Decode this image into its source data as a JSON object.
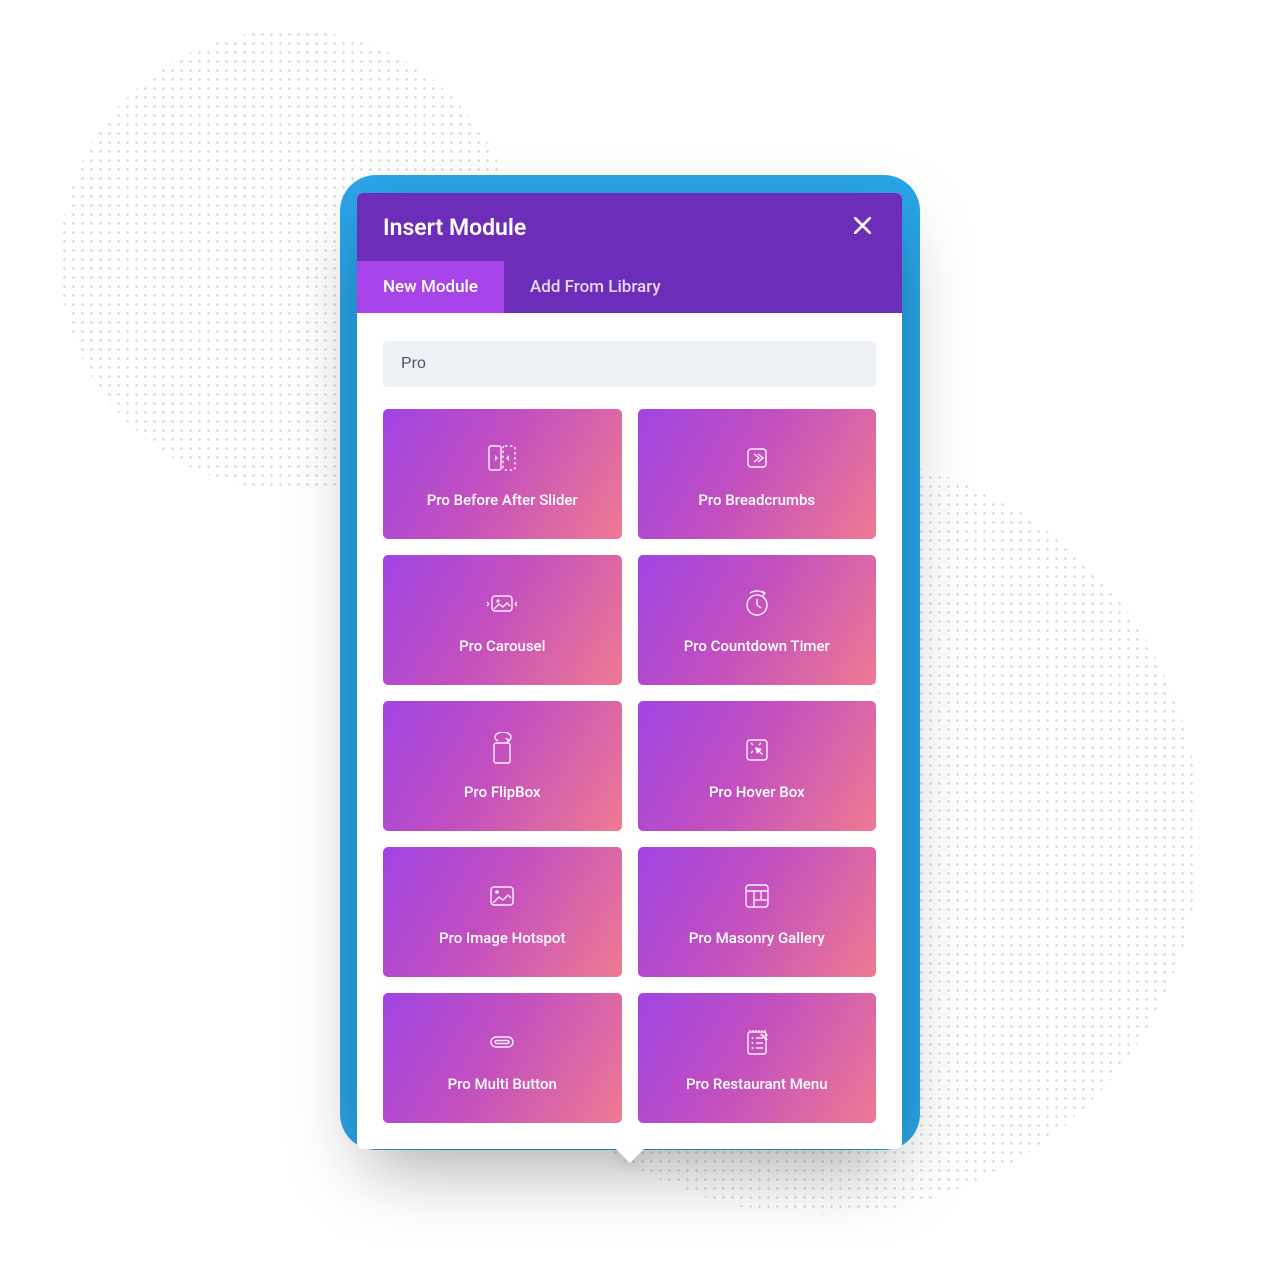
{
  "modal": {
    "title": "Insert Module",
    "tabs": [
      {
        "label": "New Module",
        "active": true
      },
      {
        "label": "Add From Library",
        "active": false
      }
    ],
    "search": {
      "value": "Pro",
      "placeholder": ""
    },
    "modules": [
      {
        "label": "Pro Before After Slider",
        "icon": "before-after-slider-icon"
      },
      {
        "label": "Pro Breadcrumbs",
        "icon": "breadcrumbs-icon"
      },
      {
        "label": "Pro Carousel",
        "icon": "carousel-icon"
      },
      {
        "label": "Pro Countdown Timer",
        "icon": "countdown-timer-icon"
      },
      {
        "label": "Pro FlipBox",
        "icon": "flipbox-icon"
      },
      {
        "label": "Pro Hover Box",
        "icon": "hover-box-icon"
      },
      {
        "label": "Pro Image Hotspot",
        "icon": "image-hotspot-icon"
      },
      {
        "label": "Pro Masonry Gallery",
        "icon": "masonry-gallery-icon"
      },
      {
        "label": "Pro Multi Button",
        "icon": "multi-button-icon"
      },
      {
        "label": "Pro Restaurant Menu",
        "icon": "restaurant-menu-icon"
      }
    ]
  },
  "colors": {
    "headerPurple": "#6c2eb9",
    "tabActivePurple": "#a644ea",
    "blueBackdrop": "#2aa6ea",
    "cardGradientStart": "#a044e3",
    "cardGradientEnd": "#ef7a92",
    "searchBg": "#eef1f5"
  }
}
